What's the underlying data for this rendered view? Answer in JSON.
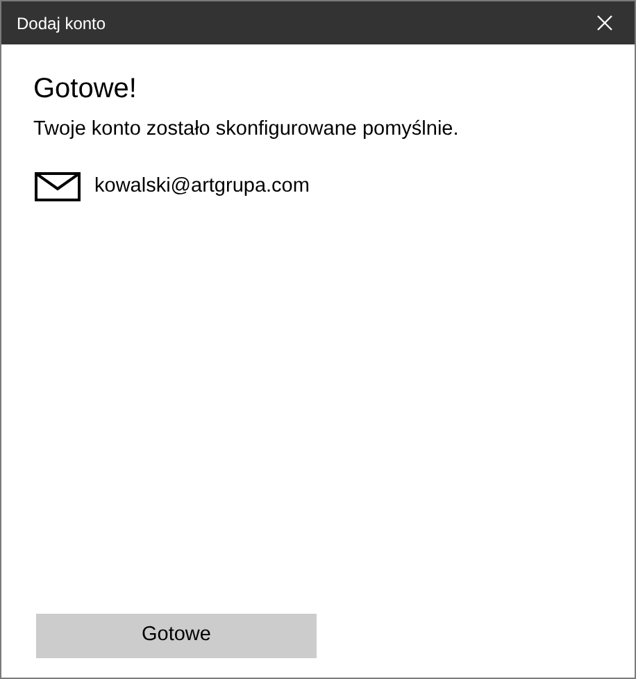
{
  "window": {
    "title": "Dodaj konto"
  },
  "heading": "Gotowe!",
  "message": "Twoje konto zostało skonfigurowane pomyślnie.",
  "account": {
    "email": "kowalski@artgrupa.com"
  },
  "buttons": [
    {
      "label": "Gotowe",
      "disabled": false
    }
  ]
}
